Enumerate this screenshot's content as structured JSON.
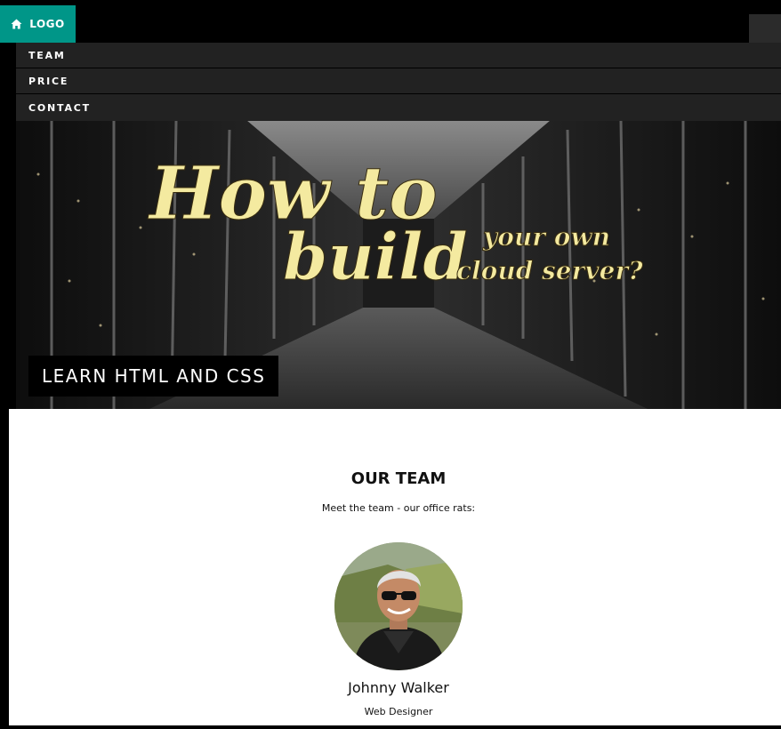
{
  "header": {
    "logo_label": "LOGO",
    "logo_icon": "home-icon",
    "accent_color": "#009688"
  },
  "nav": {
    "items": [
      {
        "label": "TEAM"
      },
      {
        "label": "PRICE"
      },
      {
        "label": "CONTACT"
      }
    ]
  },
  "hero": {
    "headline_line1": "How to",
    "headline_line2": "build",
    "headline_side1": "your own",
    "headline_side2": "cloud server?",
    "tag": "LEARN HTML AND CSS"
  },
  "team": {
    "title": "OUR TEAM",
    "subtitle": "Meet the team - our office rats:",
    "members": [
      {
        "name": "Johnny Walker",
        "role": "Web Designer"
      }
    ]
  }
}
